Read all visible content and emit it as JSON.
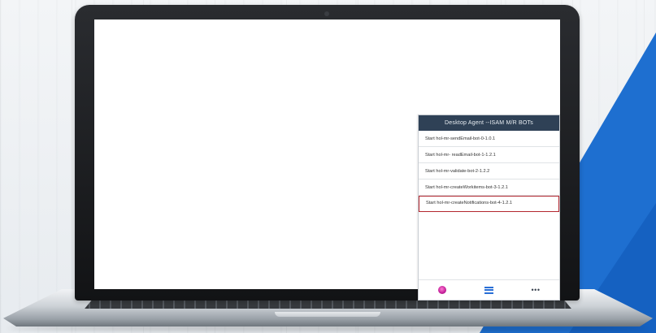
{
  "agent": {
    "title": "Desktop Agent --ISAM M/R BOTs",
    "items": [
      {
        "label": "Start hol-mr-sendEmail-bot-0-1.0.1"
      },
      {
        "label": "Start hol-mr- readEmail-bot-1-1.2.1"
      },
      {
        "label": "Start hol-mr-validate-bot-2-1.2.2"
      },
      {
        "label": "Start hol-mr-createWorkitems-bot-3-1.2.1"
      },
      {
        "label": "Start hol-mr-createNotifications-bot-4-1.2.1"
      }
    ],
    "highlighted_index": 4,
    "footer_icons": [
      "avatar-icon",
      "list-icon",
      "more-icon"
    ]
  },
  "colors": {
    "header_bg": "#2f4156",
    "highlight_border": "#b3262e",
    "accent_blue": "#1e6fd0",
    "list_icon": "#2a6fd6"
  }
}
